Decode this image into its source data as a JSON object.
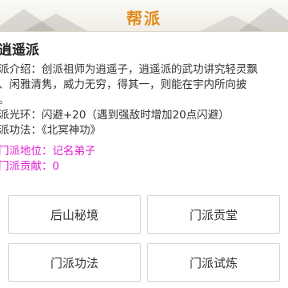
{
  "header": {
    "title": "帮派"
  },
  "sect": {
    "name": "逍遥派",
    "intro_lines": [
      "派介绍：创派祖师为逍遥子，逍遥派的武功讲究轻灵飘",
      "、闲雅清隽，威力无穷，得其一，则能在宇内所向披",
      "。"
    ],
    "aura_label": "派光环：",
    "aura_value": "闪避+20（遇到强敌时增加20点闪避）",
    "skill_label": "派功法：",
    "skill_value": "《北冥神功》",
    "status_label": "门派地位：",
    "status_value": "记名弟子",
    "contribution_label": "门派贡献：",
    "contribution_value": "0"
  },
  "buttons": {
    "houshan": "后山秘境",
    "gongtang": "门派贡堂",
    "gongfa": "门派功法",
    "shilian": "门派试炼"
  }
}
